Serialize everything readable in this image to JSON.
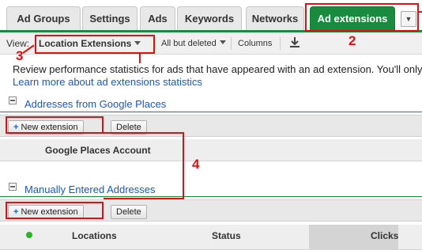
{
  "tabs": [
    {
      "label": "Ad Groups"
    },
    {
      "label": "Settings"
    },
    {
      "label": "Ads"
    },
    {
      "label": "Keywords"
    },
    {
      "label": "Networks"
    },
    {
      "label": "Ad extensions",
      "active": true
    }
  ],
  "tab_menu_icon": "dropdown-arrow-icon",
  "toolbar": {
    "view_label": "View:",
    "view_value": "Location Extensions",
    "filter_value": "All but deleted",
    "columns_label": "Columns",
    "download_icon": "download-icon"
  },
  "description": "Review performance statistics for ads that have appeared with an ad extension. You'll only",
  "learn_more_link": "Learn more about ad extensions statistics",
  "sections": [
    {
      "title": "Addresses from Google Places",
      "new_button": "New extension",
      "delete_button": "Delete",
      "columns": [
        "Google Places Account"
      ]
    },
    {
      "title": "Manually Entered Addresses",
      "new_button": "New extension",
      "delete_button": "Delete",
      "columns": [
        "Locations",
        "Status",
        "Clicks"
      ]
    }
  ],
  "annotations": {
    "num1": "2",
    "num2": "3",
    "num3": "4"
  },
  "colors": {
    "accent_green": "#1a8a3e",
    "annotation_red": "#e01010",
    "link_blue": "#1a57c4"
  }
}
